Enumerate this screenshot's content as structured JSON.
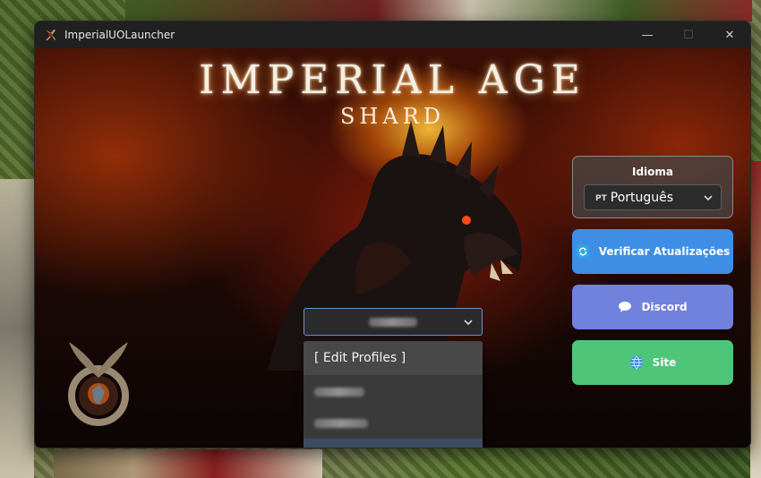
{
  "window": {
    "title": "ImperialUOLauncher",
    "controls": {
      "minimize": "—",
      "maximize": "☐",
      "close": "✕"
    }
  },
  "banner": {
    "title": "IMPERIAL AGE",
    "subtitle": "SHARD"
  },
  "profiles": {
    "selected": "",
    "menu_items": [
      "[ Edit Profiles ]"
    ]
  },
  "language": {
    "label": "Idioma",
    "flag": "PT",
    "selected": "Português"
  },
  "buttons": {
    "update": "Verificar Atualizações",
    "discord": "Discord",
    "site": "Site"
  },
  "colors": {
    "update": "#3f8ee6",
    "discord": "#7182dd",
    "site": "#4fc57a",
    "profile_border": "#6d8fd1"
  },
  "icons": {
    "update": "refresh-icon",
    "discord": "chat-bubble-icon",
    "site": "globe-icon"
  }
}
